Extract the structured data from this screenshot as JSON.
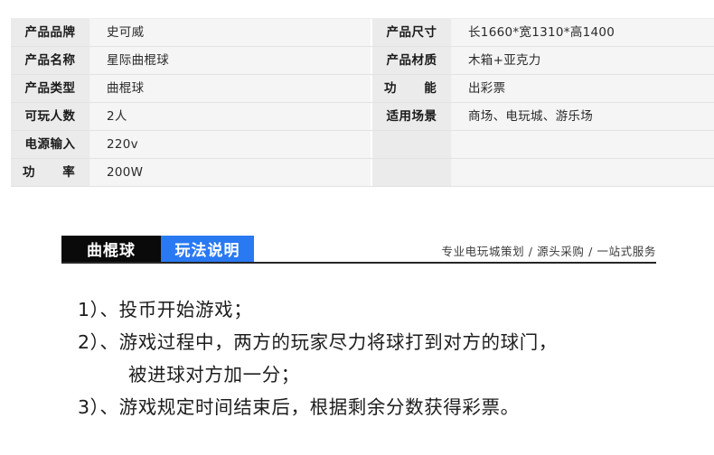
{
  "spec_table": {
    "rows": [
      {
        "left_label": "产品品牌",
        "left_value": "史可威",
        "right_label": "产品尺寸",
        "right_value": "长1660*宽1310*高1400"
      },
      {
        "left_label": "产品名称",
        "left_value": "星际曲棍球",
        "right_label": "产品材质",
        "right_value": "木箱+亚克力"
      },
      {
        "left_label": "产品类型",
        "left_value": "曲棍球",
        "right_label": "功 能",
        "right_value": "出彩票"
      },
      {
        "left_label": "可玩人数",
        "left_value": "2人",
        "right_label": "适用场景",
        "right_value": "商场、电玩城、游乐场"
      },
      {
        "left_label": "电源输入",
        "left_value": "220v",
        "right_label": "",
        "right_value": ""
      },
      {
        "left_label": "功 率",
        "left_value": "200W",
        "right_label": "",
        "right_value": ""
      }
    ]
  },
  "section_header": {
    "tab_product": "曲棍球",
    "tab_active": "玩法说明",
    "tagline": "专业电玩城策划 / 源头采购 / 一站式服务",
    "accent_color": "#2979f2",
    "dark_color": "#0a0a0a"
  },
  "rules": {
    "items": [
      "1）、投币开始游戏；",
      "2）、游戏过程中，两方的玩家尽力将球打到对方的球门，",
      "被进球对方加一分；",
      "3）、游戏规定时间结束后，根据剩余分数获得彩票。"
    ]
  }
}
